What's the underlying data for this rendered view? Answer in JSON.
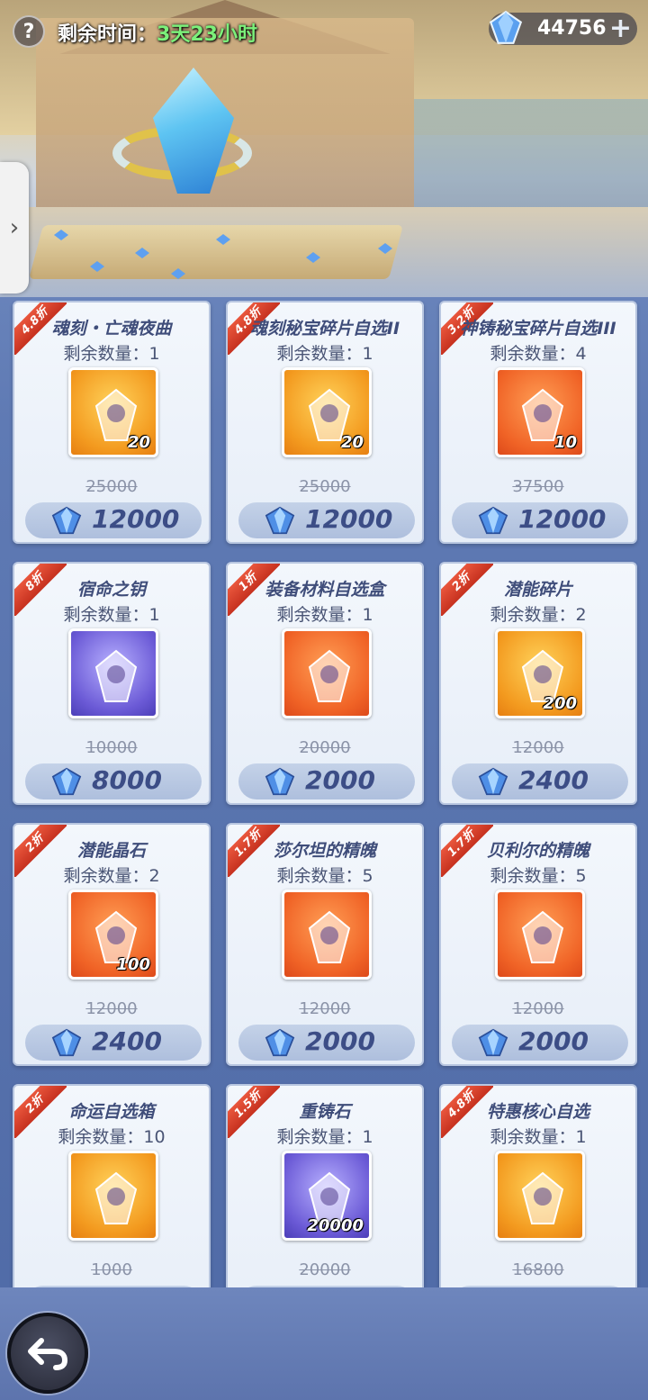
{
  "top": {
    "help_label": "?",
    "time_label": "剩余时间：",
    "time_value": "3天23小时",
    "gems": "44756",
    "plus_label": "+"
  },
  "side_tab": {
    "label": "›"
  },
  "colors": {
    "accent_green": "#7cf07a",
    "ribbon_red": "#d63d27",
    "title_text": "#3f4d7a"
  },
  "items": [
    {
      "discount": "4.8折",
      "name": "魂刻・亡魂夜曲",
      "remain": "剩余数量：1",
      "qty": "20",
      "original": "25000",
      "price": "12000",
      "icon": "weapon-scroll-icon",
      "bg": "orange"
    },
    {
      "discount": "4.8折",
      "name": "魂刻秘宝碎片自选II",
      "remain": "剩余数量：1",
      "qty": "20",
      "original": "25000",
      "price": "12000",
      "icon": "treasure-shard-icon",
      "bg": "orange"
    },
    {
      "discount": "3.2折",
      "name": "神铸秘宝碎片自选III",
      "remain": "剩余数量：4",
      "qty": "10",
      "original": "37500",
      "price": "12000",
      "icon": "treasure-shard-icon",
      "bg": "red"
    },
    {
      "discount": "8折",
      "name": "宿命之钥",
      "remain": "剩余数量：1",
      "qty": "",
      "original": "10000",
      "price": "8000",
      "icon": "key-icon",
      "bg": "purple"
    },
    {
      "discount": "1折",
      "name": "装备材料自选盒",
      "remain": "剩余数量：1",
      "qty": "",
      "original": "20000",
      "price": "2000",
      "icon": "armor-box-icon",
      "bg": "red"
    },
    {
      "discount": "2折",
      "name": "潜能碎片",
      "remain": "剩余数量：2",
      "qty": "200",
      "original": "12000",
      "price": "2400",
      "icon": "potential-shard-icon",
      "bg": "orange"
    },
    {
      "discount": "2折",
      "name": "潜能晶石",
      "remain": "剩余数量：2",
      "qty": "100",
      "original": "12000",
      "price": "2400",
      "icon": "star-crystal-icon",
      "bg": "red"
    },
    {
      "discount": "1.7折",
      "name": "莎尔坦的精魄",
      "remain": "剩余数量：5",
      "qty": "",
      "original": "12000",
      "price": "2000",
      "icon": "dark-orb-icon",
      "bg": "red"
    },
    {
      "discount": "1.7折",
      "name": "贝利尔的精魄",
      "remain": "剩余数量：5",
      "qty": "",
      "original": "12000",
      "price": "2000",
      "icon": "red-orb-icon",
      "bg": "red"
    },
    {
      "discount": "2折",
      "name": "命运自选箱",
      "remain": "剩余数量：10",
      "qty": "",
      "original": "1000",
      "price": "",
      "icon": "chest-icon",
      "bg": "orange"
    },
    {
      "discount": "1.5折",
      "name": "重铸石",
      "remain": "剩余数量：1",
      "qty": "20000",
      "original": "20000",
      "price": "",
      "icon": "reforge-stone-icon",
      "bg": "purple"
    },
    {
      "discount": "4.8折",
      "name": "特惠核心自选",
      "remain": "剩余数量：1",
      "qty": "",
      "original": "16800",
      "price": "",
      "icon": "core-card-icon",
      "bg": "orange"
    }
  ]
}
